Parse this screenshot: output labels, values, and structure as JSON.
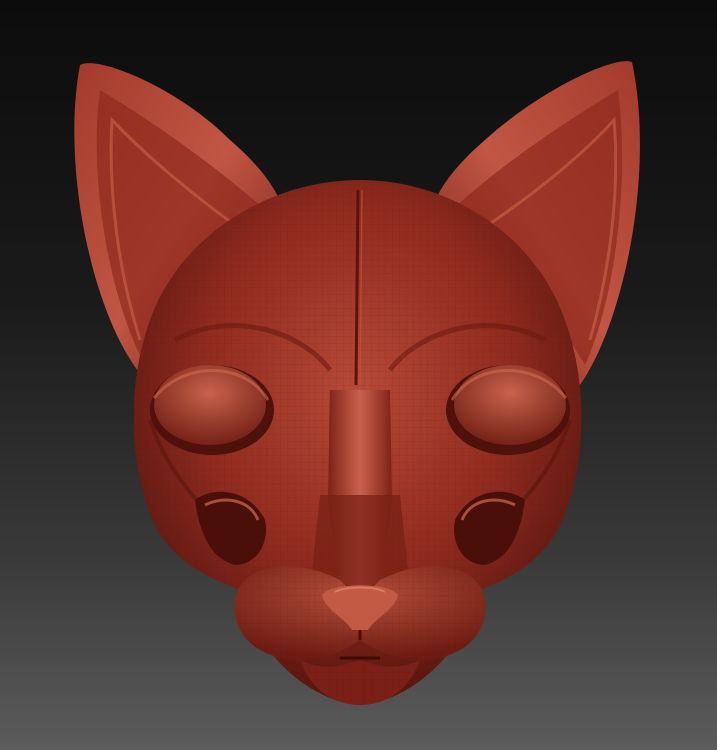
{
  "scene": {
    "subject": "sculpted-cat-head",
    "material": {
      "base": "#8e2a1e",
      "highlight": "#d0604a",
      "shadow": "#3a0c08"
    },
    "background": {
      "top": "#0c0c0c",
      "bottom": "#5c5c5c"
    }
  }
}
